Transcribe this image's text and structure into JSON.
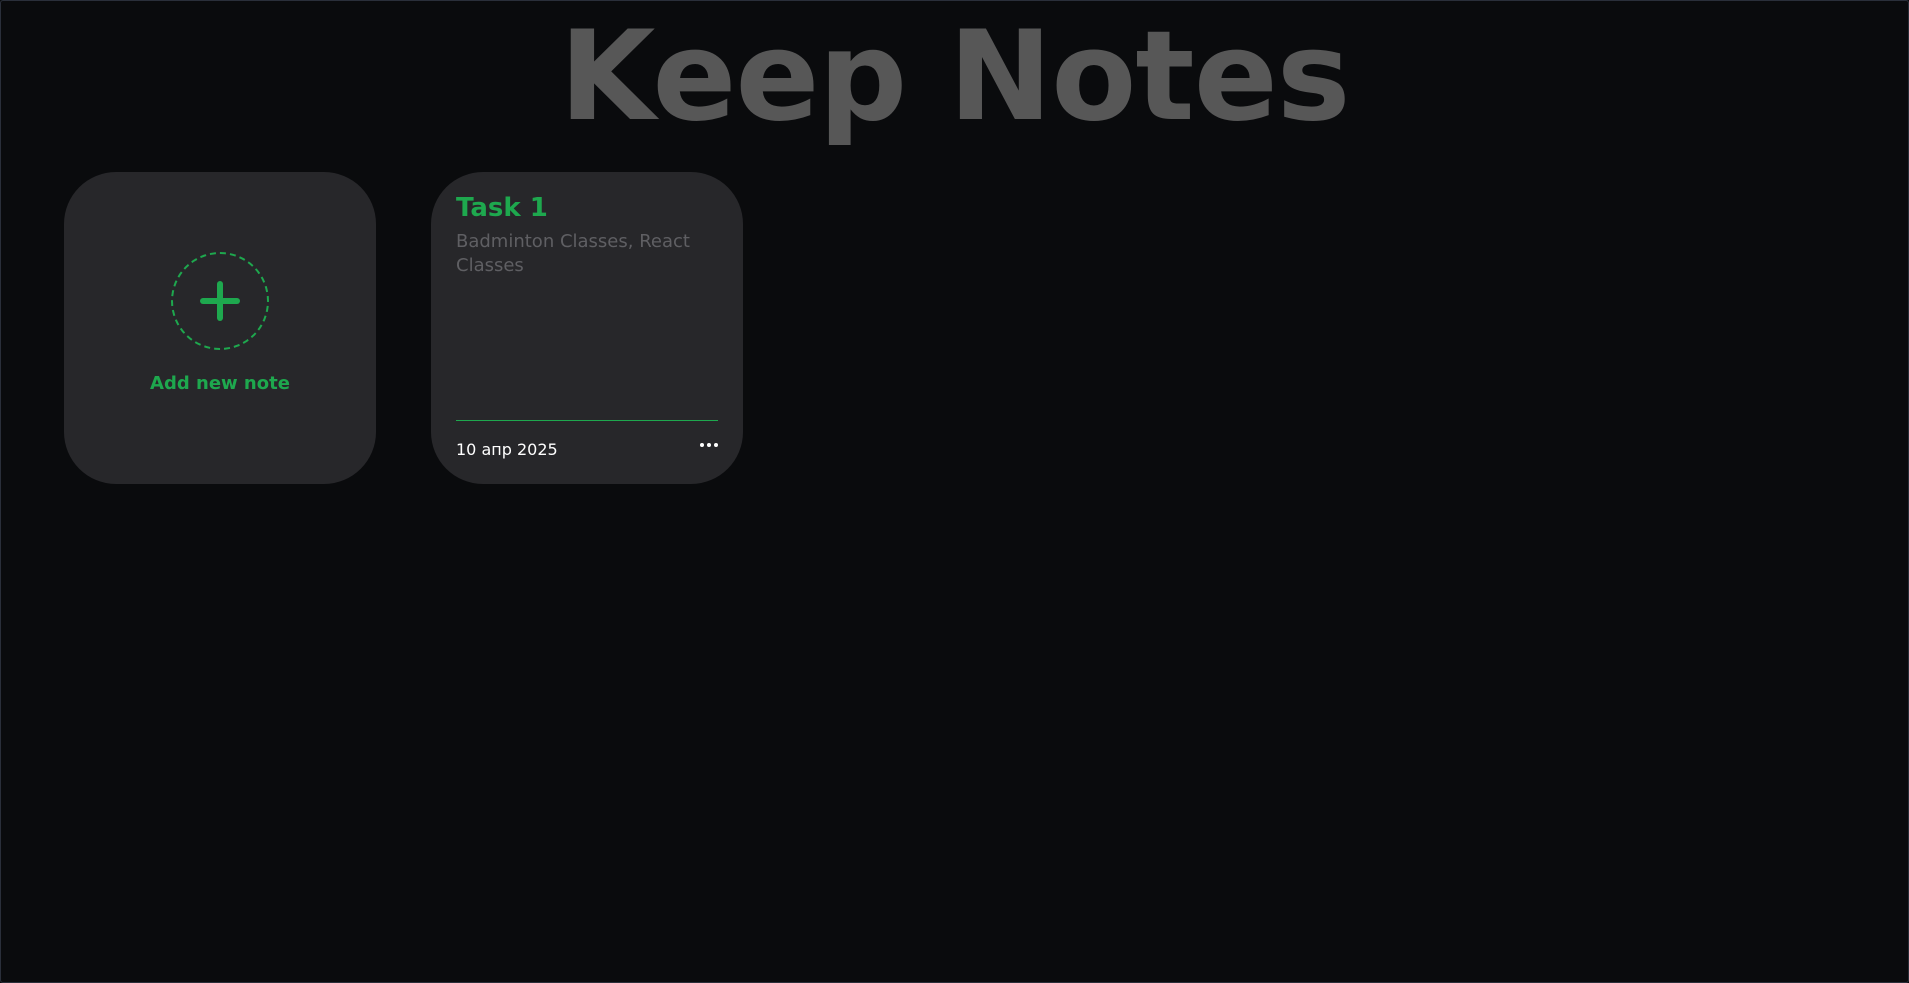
{
  "app": {
    "title": "Keep Notes"
  },
  "add_card": {
    "label": "Add new note",
    "icon": "plus-icon"
  },
  "notes": [
    {
      "title": "Task 1",
      "body": "Badminton Classes, React Classes",
      "date": "10 апр 2025",
      "menu_icon": "more-horizontal-icon"
    }
  ],
  "colors": {
    "background": "#0a0b0d",
    "card": "#27272a",
    "accent": "#1ea84e",
    "title": "#575757",
    "muted_text": "#5f5f63"
  }
}
